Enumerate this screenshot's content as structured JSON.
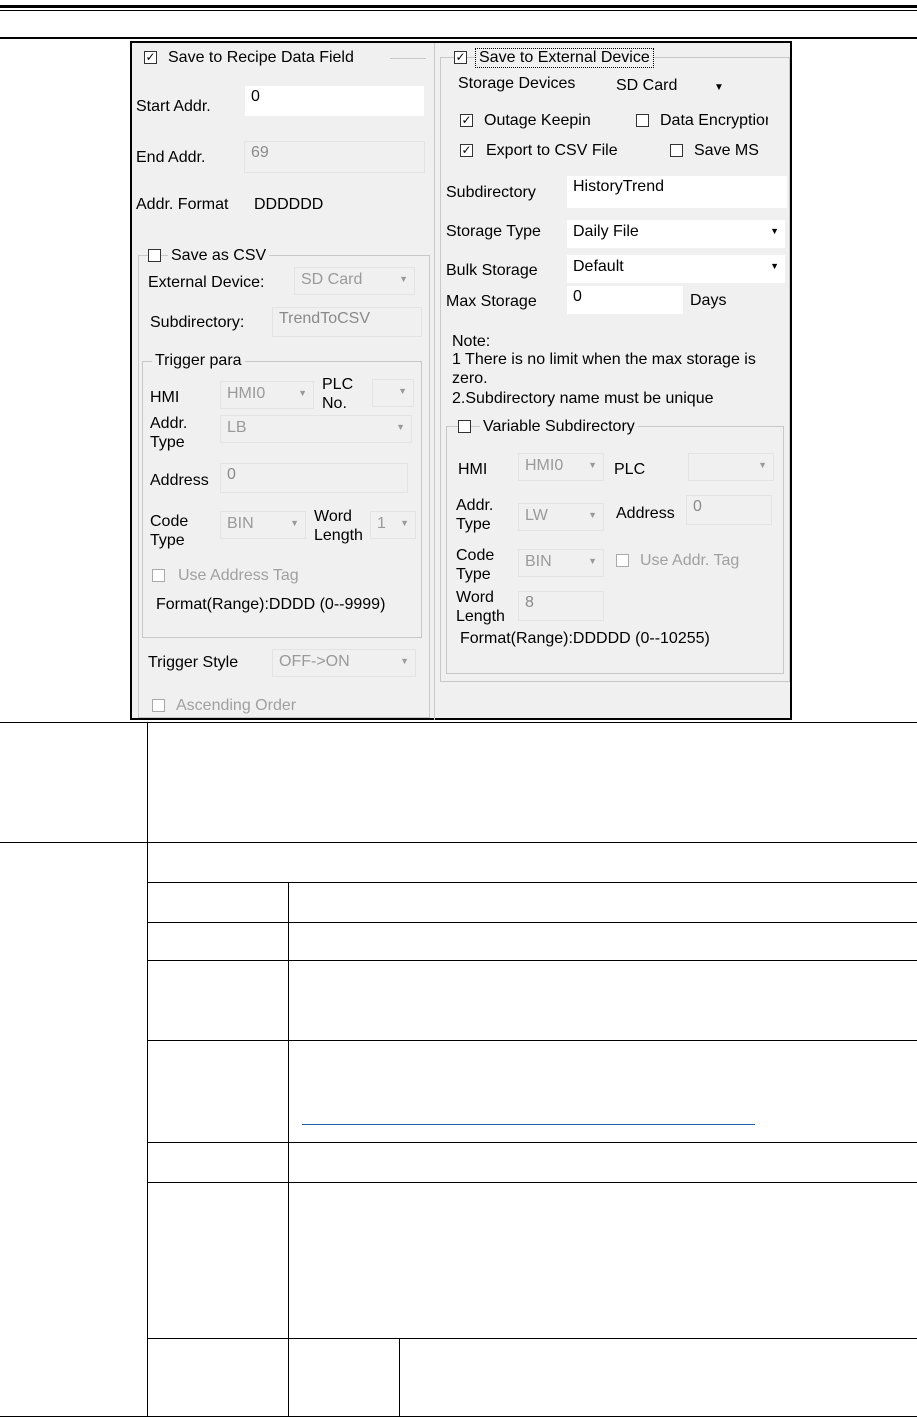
{
  "left_panel": {
    "save_recipe_label": "Save to Recipe Data Field",
    "start_addr_label": "Start Addr.",
    "start_addr_value": "0",
    "end_addr_label": "End Addr.",
    "end_addr_value": "69",
    "addr_format_label": "Addr. Format",
    "addr_format_value": "DDDDDD",
    "save_csv_label": "Save as CSV",
    "external_device_label": "External Device:",
    "external_device_value": "SD Card",
    "subdirectory_label": "Subdirectory:",
    "subdirectory_value": "TrendToCSV",
    "trigger_para_label": "Trigger para",
    "hmi_label": "HMI",
    "hmi_value": "HMI0",
    "plc_no_label_1": "PLC",
    "plc_no_label_2": "No.",
    "addr_type_label_1": "Addr.",
    "addr_type_label_2": "Type",
    "addr_type_value": "LB",
    "address_label": "Address",
    "address_value": "0",
    "code_type_label_1": "Code",
    "code_type_label_2": "Type",
    "code_type_value": "BIN",
    "word_length_label_1": "Word",
    "word_length_label_2": "Length",
    "word_length_value": "1",
    "use_address_tag_label": "Use Address Tag",
    "format_range": "Format(Range):DDDD (0--9999)",
    "trigger_style_label": "Trigger Style",
    "trigger_style_value": "OFF->ON",
    "ascending_order_label": "Ascending Order"
  },
  "right_panel": {
    "save_external_label": "Save to External Device",
    "storage_devices_label": "Storage Devices",
    "storage_devices_value": "SD Card",
    "outage_keepin_label": "Outage Keepin",
    "data_encryption_label": "Data Encryption",
    "export_csv_label": "Export to CSV File",
    "save_ms_label": "Save MS",
    "subdirectory_label": "Subdirectory",
    "subdirectory_value": "HistoryTrend",
    "storage_type_label": "Storage Type",
    "storage_type_value": "Daily File",
    "bulk_storage_label": "Bulk Storage",
    "bulk_storage_value": "Default",
    "max_storage_label": "Max Storage",
    "max_storage_value": "0",
    "days_label": "Days",
    "note_title": "Note:",
    "note_line1": "1 There is no limit when the max storage is",
    "note_line2": "zero.",
    "note_line3": "2.Subdirectory name must be unique",
    "variable_subdirectory_label": "Variable Subdirectory",
    "hmi_label": "HMI",
    "hmi_value": "HMI0",
    "plc_label": "PLC",
    "plc_value": "",
    "addr_type_label_1": "Addr.",
    "addr_type_label_2": "Type",
    "addr_type_value": "LW",
    "address_label": "Address",
    "address_value": "0",
    "code_type_label_1": "Code",
    "code_type_label_2": "Type",
    "code_type_value": "BIN",
    "use_addr_tag_label": "Use Addr. Tag",
    "word_length_label_1": "Word",
    "word_length_label_2": "Length",
    "word_length_value": "8",
    "format_range": "Format(Range):DDDDD (0--10255)"
  },
  "colors": {
    "dialog_bg": "#f0f0f0",
    "link_blue": "#1f5fa8",
    "disabled_text": "#a0a0a0"
  }
}
